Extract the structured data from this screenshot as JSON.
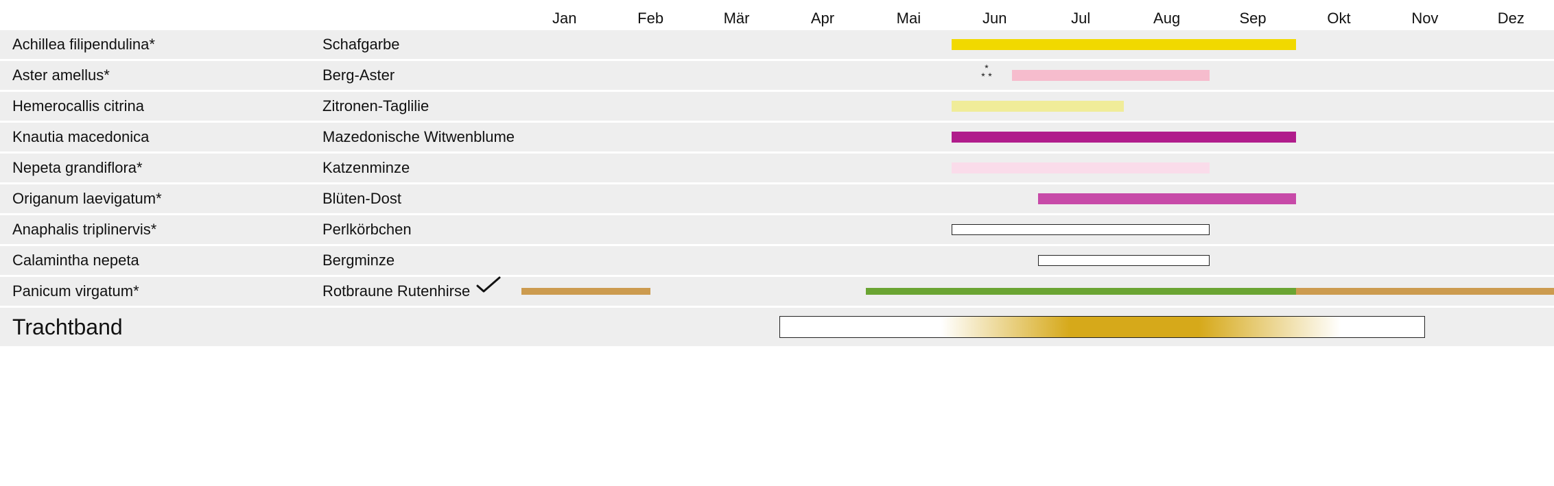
{
  "months": [
    "Jan",
    "Feb",
    "Mär",
    "Apr",
    "Mai",
    "Jun",
    "Jul",
    "Aug",
    "Sep",
    "Okt",
    "Nov",
    "Dez"
  ],
  "plants": [
    {
      "latin": "Achillea filipendulina*",
      "common": "Schafgarbe",
      "bars": [
        {
          "start": 6.0,
          "end": 10.0,
          "color": "#f1d900"
        }
      ]
    },
    {
      "latin": "Aster amellus*",
      "common": "Berg-Aster",
      "bars": [
        {
          "start": 6.7,
          "end": 9.0,
          "color": "#f6bccd"
        }
      ],
      "asterisks": {
        "at": 6.3
      }
    },
    {
      "latin": "Hemerocallis citrina",
      "common": "Zitronen-Taglilie",
      "bars": [
        {
          "start": 6.0,
          "end": 8.0,
          "color": "#f0ec99"
        }
      ]
    },
    {
      "latin": "Knautia macedonica",
      "common": "Mazedonische Witwenblume",
      "bars": [
        {
          "start": 6.0,
          "end": 10.0,
          "color": "#b01c8b"
        }
      ]
    },
    {
      "latin": "Nepeta grandiflora*",
      "common": "Katzenminze",
      "bars": [
        {
          "start": 6.0,
          "end": 9.0,
          "color": "#fadcea"
        }
      ]
    },
    {
      "latin": "Origanum laevigatum*",
      "common": "Blüten-Dost",
      "bars": [
        {
          "start": 7.0,
          "end": 10.0,
          "color": "#c74aa8"
        }
      ]
    },
    {
      "latin": "Anaphalis triplinervis*",
      "common": "Perlkörbchen",
      "bars": [
        {
          "start": 6.0,
          "end": 9.0,
          "outlined": true
        }
      ]
    },
    {
      "latin": "Calamintha nepeta",
      "common": "Bergminze",
      "bars": [
        {
          "start": 7.0,
          "end": 9.0,
          "outlined": true
        }
      ]
    },
    {
      "latin": "Panicum virgatum*",
      "common": "Rotbraune Rutenhirse",
      "bars": [
        {
          "start": 1.0,
          "end": 2.5,
          "color": "#cc9b4f",
          "thin": true
        },
        {
          "start": 5.0,
          "end": 10.0,
          "color": "#6aa432",
          "thin": true
        },
        {
          "start": 10.0,
          "end": 13.0,
          "color": "#cc9b4f",
          "thin": true
        }
      ],
      "check": {
        "at": 0.7
      }
    }
  ],
  "footer_label": "Trachtband",
  "trachtband": {
    "start": 4.0,
    "end": 11.5
  },
  "chart_data": {
    "type": "gantt",
    "title": "",
    "x_axis": {
      "unit": "month",
      "labels": [
        "Jan",
        "Feb",
        "Mär",
        "Apr",
        "Mai",
        "Jun",
        "Jul",
        "Aug",
        "Sep",
        "Okt",
        "Nov",
        "Dez"
      ],
      "range": [
        1,
        13
      ]
    },
    "series": [
      {
        "name": "Achillea filipendulina*",
        "common": "Schafgarbe",
        "segments": [
          {
            "start": 6.0,
            "end": 10.0,
            "color": "#f1d900",
            "kind": "bloom"
          }
        ]
      },
      {
        "name": "Aster amellus*",
        "common": "Berg-Aster",
        "segments": [
          {
            "start": 6.7,
            "end": 9.0,
            "color": "#f6bccd",
            "kind": "bloom"
          }
        ],
        "note": "insect-value-mark"
      },
      {
        "name": "Hemerocallis citrina",
        "common": "Zitronen-Taglilie",
        "segments": [
          {
            "start": 6.0,
            "end": 8.0,
            "color": "#f0ec99",
            "kind": "bloom"
          }
        ]
      },
      {
        "name": "Knautia macedonica",
        "common": "Mazedonische Witwenblume",
        "segments": [
          {
            "start": 6.0,
            "end": 10.0,
            "color": "#b01c8b",
            "kind": "bloom"
          }
        ]
      },
      {
        "name": "Nepeta grandiflora*",
        "common": "Katzenminze",
        "segments": [
          {
            "start": 6.0,
            "end": 9.0,
            "color": "#fadcea",
            "kind": "bloom"
          }
        ]
      },
      {
        "name": "Origanum laevigatum*",
        "common": "Blüten-Dost",
        "segments": [
          {
            "start": 7.0,
            "end": 10.0,
            "color": "#c74aa8",
            "kind": "bloom"
          }
        ]
      },
      {
        "name": "Anaphalis triplinervis*",
        "common": "Perlkörbchen",
        "segments": [
          {
            "start": 6.0,
            "end": 9.0,
            "color": "#ffffff",
            "kind": "bloom",
            "outlined": true
          }
        ]
      },
      {
        "name": "Calamintha nepeta",
        "common": "Bergminze",
        "segments": [
          {
            "start": 7.0,
            "end": 9.0,
            "color": "#ffffff",
            "kind": "bloom",
            "outlined": true
          }
        ]
      },
      {
        "name": "Panicum virgatum*",
        "common": "Rotbraune Rutenhirse",
        "segments": [
          {
            "start": 1.0,
            "end": 2.5,
            "color": "#cc9b4f",
            "kind": "foliage-dormant"
          },
          {
            "start": 5.0,
            "end": 10.0,
            "color": "#6aa432",
            "kind": "foliage-green"
          },
          {
            "start": 10.0,
            "end": 13.0,
            "color": "#cc9b4f",
            "kind": "foliage-dormant"
          }
        ],
        "note": "check-mark"
      }
    ],
    "summary_band": {
      "label": "Trachtband",
      "start": 4.0,
      "end": 11.5,
      "peak_start": 6.0,
      "peak_end": 10.0,
      "color": "#d6a91a"
    }
  }
}
